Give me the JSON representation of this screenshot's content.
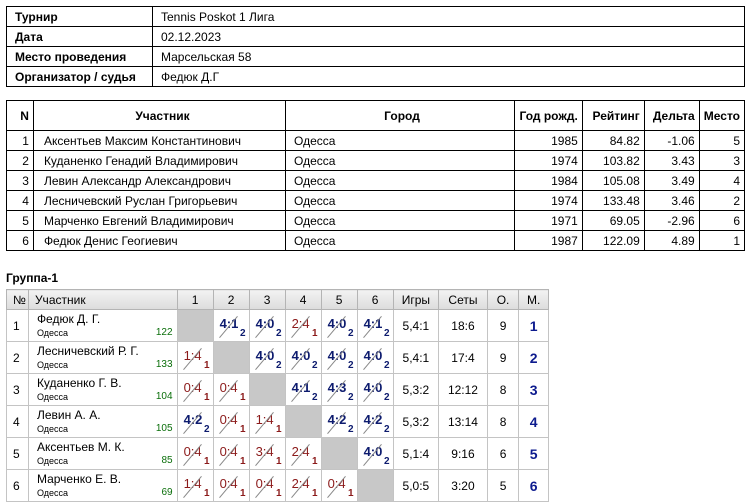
{
  "info": [
    {
      "label": "Турнир",
      "value": "Tennis Poskot 1 Лига"
    },
    {
      "label": "Дата",
      "value": "02.12.2023"
    },
    {
      "label": "Место проведения",
      "value": "Марсельская 58"
    },
    {
      "label": "Организатор / судья",
      "value": "Федюк Д.Г"
    }
  ],
  "participants": {
    "headers": [
      "N",
      "Участник",
      "Город",
      "Год рожд.",
      "Рейтинг",
      "Дельта",
      "Место"
    ],
    "rows": [
      [
        "1",
        "Аксентьев Максим Константинович",
        "Одесса",
        "1985",
        "84.82",
        "-1.06",
        "5"
      ],
      [
        "2",
        "Куданенко Генадий Владимирович",
        "Одесса",
        "1974",
        "103.82",
        "3.43",
        "3"
      ],
      [
        "3",
        "Левин Александр Александрович",
        "Одесса",
        "1984",
        "105.08",
        "3.49",
        "4"
      ],
      [
        "4",
        "Лесничевский Руслан Григорьевич",
        "Одесса",
        "1974",
        "133.48",
        "3.46",
        "2"
      ],
      [
        "5",
        "Марченко Евгений Владимирович",
        "Одесса",
        "1971",
        "69.05",
        "-2.96",
        "6"
      ],
      [
        "6",
        "Федюк Денис Геогиевич",
        "Одесса",
        "1987",
        "122.09",
        "4.89",
        "1"
      ]
    ]
  },
  "group": {
    "title": "Группа-1",
    "headers": [
      "№",
      "Участник",
      "1",
      "2",
      "3",
      "4",
      "5",
      "6",
      "Игры",
      "Сеты",
      "О.",
      "М."
    ],
    "rows": [
      {
        "num": "1",
        "name": "Федюк Д. Г.",
        "city": "Одесса",
        "rating": "122",
        "cells": [
          null,
          {
            "s": "4:1",
            "p": "2",
            "w": true
          },
          {
            "s": "4:0",
            "p": "2",
            "w": true
          },
          {
            "s": "2:4",
            "p": "1",
            "w": false
          },
          {
            "s": "4:0",
            "p": "2",
            "w": true
          },
          {
            "s": "4:1",
            "p": "2",
            "w": true
          }
        ],
        "games": "5,4:1",
        "sets": "18:6",
        "points": "9",
        "place": "1"
      },
      {
        "num": "2",
        "name": "Лесничевский Р. Г.",
        "city": "Одесса",
        "rating": "133",
        "cells": [
          {
            "s": "1:4",
            "p": "1",
            "w": false
          },
          null,
          {
            "s": "4:0",
            "p": "2",
            "w": true
          },
          {
            "s": "4:0",
            "p": "2",
            "w": true
          },
          {
            "s": "4:0",
            "p": "2",
            "w": true
          },
          {
            "s": "4:0",
            "p": "2",
            "w": true
          }
        ],
        "games": "5,4:1",
        "sets": "17:4",
        "points": "9",
        "place": "2"
      },
      {
        "num": "3",
        "name": "Куданенко Г. В.",
        "city": "Одесса",
        "rating": "104",
        "cells": [
          {
            "s": "0:4",
            "p": "1",
            "w": false
          },
          {
            "s": "0:4",
            "p": "1",
            "w": false
          },
          null,
          {
            "s": "4:1",
            "p": "2",
            "w": true
          },
          {
            "s": "4:3",
            "p": "2",
            "w": true
          },
          {
            "s": "4:0",
            "p": "2",
            "w": true
          }
        ],
        "games": "5,3:2",
        "sets": "12:12",
        "points": "8",
        "place": "3"
      },
      {
        "num": "4",
        "name": "Левин А. А.",
        "city": "Одесса",
        "rating": "105",
        "cells": [
          {
            "s": "4:2",
            "p": "2",
            "w": true
          },
          {
            "s": "0:4",
            "p": "1",
            "w": false
          },
          {
            "s": "1:4",
            "p": "1",
            "w": false
          },
          null,
          {
            "s": "4:2",
            "p": "2",
            "w": true
          },
          {
            "s": "4:2",
            "p": "2",
            "w": true
          }
        ],
        "games": "5,3:2",
        "sets": "13:14",
        "points": "8",
        "place": "4"
      },
      {
        "num": "5",
        "name": "Аксентьев М. К.",
        "city": "Одесса",
        "rating": "85",
        "cells": [
          {
            "s": "0:4",
            "p": "1",
            "w": false
          },
          {
            "s": "0:4",
            "p": "1",
            "w": false
          },
          {
            "s": "3:4",
            "p": "1",
            "w": false
          },
          {
            "s": "2:4",
            "p": "1",
            "w": false
          },
          null,
          {
            "s": "4:0",
            "p": "2",
            "w": true
          }
        ],
        "games": "5,1:4",
        "sets": "9:16",
        "points": "6",
        "place": "5"
      },
      {
        "num": "6",
        "name": "Марченко Е. В.",
        "city": "Одесса",
        "rating": "69",
        "cells": [
          {
            "s": "1:4",
            "p": "1",
            "w": false
          },
          {
            "s": "0:4",
            "p": "1",
            "w": false
          },
          {
            "s": "0:4",
            "p": "1",
            "w": false
          },
          {
            "s": "2:4",
            "p": "1",
            "w": false
          },
          {
            "s": "0:4",
            "p": "1",
            "w": false
          },
          null
        ],
        "games": "5,0:5",
        "sets": "3:20",
        "points": "5",
        "place": "6"
      }
    ]
  }
}
